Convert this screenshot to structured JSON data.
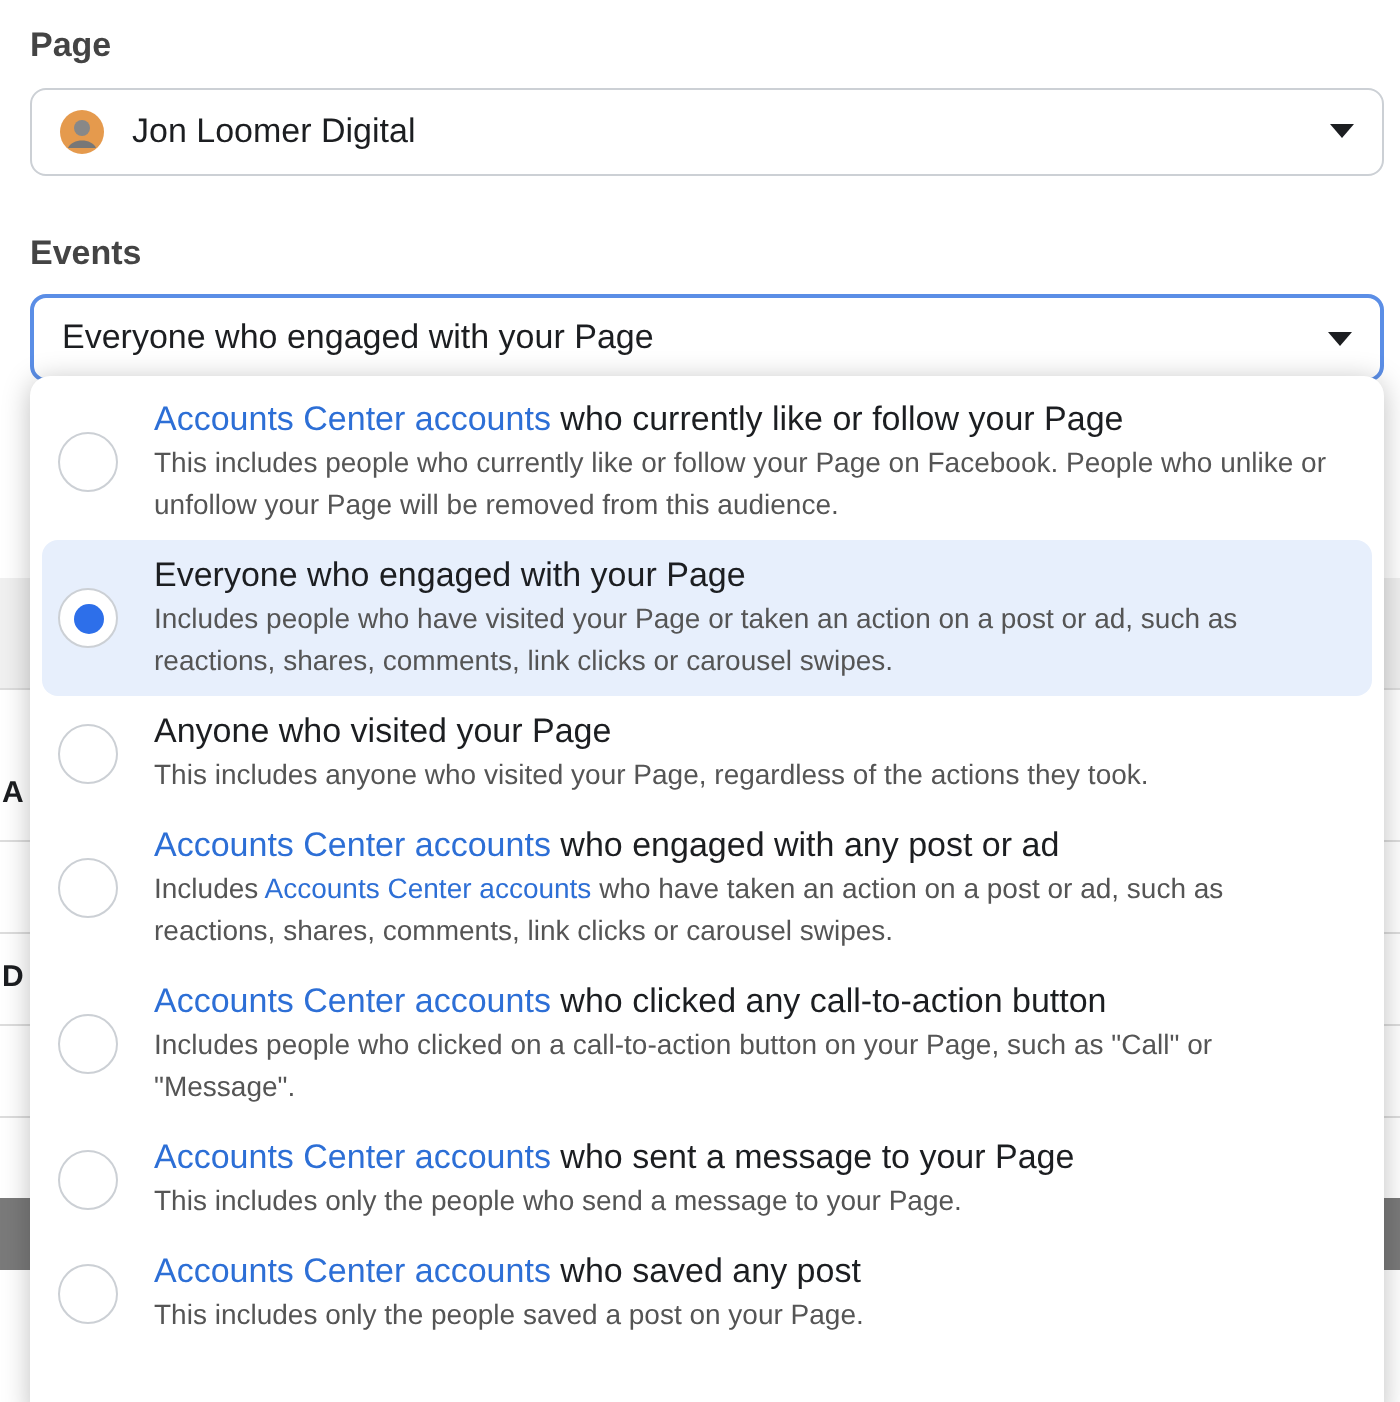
{
  "page_field": {
    "label": "Page",
    "value": "Jon Loomer Digital"
  },
  "events_field": {
    "label": "Events",
    "value": "Everyone who engaged with your Page",
    "focused": true
  },
  "background_labels": [
    "A",
    "D"
  ],
  "options": [
    {
      "selected": false,
      "title": [
        {
          "kind": "link",
          "text": "Accounts Center accounts"
        },
        {
          "kind": "plain",
          "text": " who currently like or follow your Page"
        }
      ],
      "description": [
        {
          "kind": "plain",
          "text": "This includes people who currently like or follow your Page on Facebook. People who unlike or unfollow your Page will be removed from this audience."
        }
      ]
    },
    {
      "selected": true,
      "title": [
        {
          "kind": "plain",
          "text": "Everyone who engaged with your Page"
        }
      ],
      "description": [
        {
          "kind": "plain",
          "text": "Includes people who have visited your Page or taken an action on a post or ad, such as reactions, shares, comments, link clicks or carousel swipes."
        }
      ]
    },
    {
      "selected": false,
      "title": [
        {
          "kind": "plain",
          "text": "Anyone who visited your Page"
        }
      ],
      "description": [
        {
          "kind": "plain",
          "text": "This includes anyone who visited your Page, regardless of the actions they took."
        }
      ]
    },
    {
      "selected": false,
      "title": [
        {
          "kind": "link",
          "text": "Accounts Center accounts"
        },
        {
          "kind": "plain",
          "text": " who engaged with any post or ad"
        }
      ],
      "description": [
        {
          "kind": "plain",
          "text": "Includes "
        },
        {
          "kind": "link",
          "text": "Accounts Center accounts"
        },
        {
          "kind": "plain",
          "text": " who have taken an action on a post or ad, such as reactions, shares, comments, link clicks or carousel swipes."
        }
      ]
    },
    {
      "selected": false,
      "title": [
        {
          "kind": "link",
          "text": "Accounts Center accounts"
        },
        {
          "kind": "plain",
          "text": " who clicked any call-to-action button"
        }
      ],
      "description": [
        {
          "kind": "plain",
          "text": "Includes people who clicked on a call-to-action button on your Page, such as \"Call\" or \"Message\"."
        }
      ]
    },
    {
      "selected": false,
      "title": [
        {
          "kind": "link",
          "text": "Accounts Center accounts"
        },
        {
          "kind": "plain",
          "text": " who sent a message to your Page"
        }
      ],
      "description": [
        {
          "kind": "plain",
          "text": "This includes only the people who send a message to your Page."
        }
      ]
    },
    {
      "selected": false,
      "title": [
        {
          "kind": "link",
          "text": "Accounts Center accounts"
        },
        {
          "kind": "plain",
          "text": " who saved any post"
        }
      ],
      "description": [
        {
          "kind": "plain",
          "text": "This includes only the people saved a post on your Page."
        }
      ]
    }
  ]
}
